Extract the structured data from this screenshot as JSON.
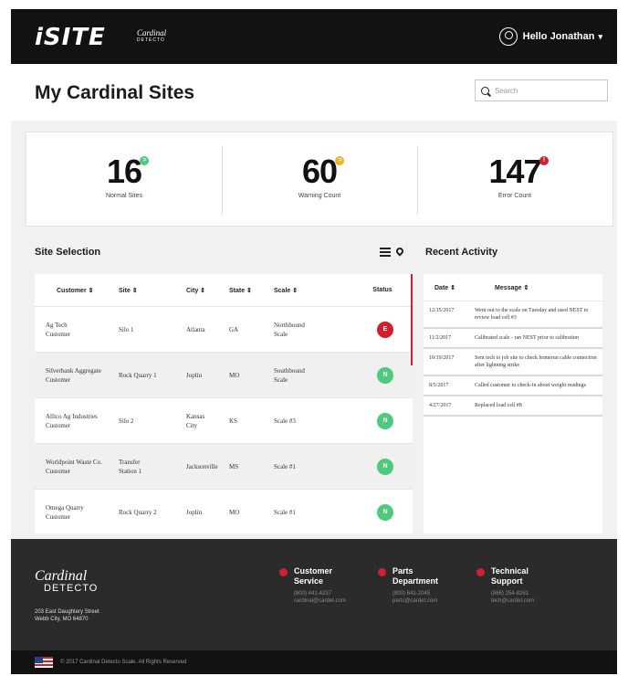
{
  "header": {
    "logo_text": "iSITE",
    "logo_sub": "Cardinal",
    "logo_sub2": "DETECTO",
    "greeting": "Hello Jonathan",
    "chevron": "chevron-down-icon"
  },
  "page": {
    "title": "My Cardinal Sites",
    "search_placeholder": "Search"
  },
  "stats": [
    {
      "value": "16",
      "label": "Normal Sites",
      "badge_color": "#4dca7c",
      "badge": ">"
    },
    {
      "value": "60",
      "label": "Warning Count",
      "badge_color": "#f0b429",
      "badge": ">"
    },
    {
      "value": "147",
      "label": "Error Count",
      "badge_color": "#d0202e",
      "badge": "!"
    }
  ],
  "site_selection": {
    "title": "Site Selection",
    "columns": [
      "Customer ⇕",
      "Site ⇕",
      "City ⇕",
      "State ⇕",
      "Scale ⇕",
      "Status"
    ],
    "rows": [
      {
        "customer": "Ag Tech\nCustomer",
        "site": "Silo 1",
        "city": "Atlanta",
        "state": "GA",
        "scale": "Northbound\nScale",
        "status": "E"
      },
      {
        "customer": "Silverbank Aggregate\nCustomer",
        "site": "Rock Quarry 1",
        "city": "Joplin",
        "state": "MO",
        "scale": "Southbound\nScale",
        "status": "N"
      },
      {
        "customer": "Allico Ag Industries\nCustomer",
        "site": "Silo 2",
        "city": "Kansas\nCity",
        "state": "KS",
        "scale": "Scale #3",
        "status": "N"
      },
      {
        "customer": "Worldpoint Waste Co.\nCustomer",
        "site": "Transfer\nStation 1",
        "city": "Jacksonville",
        "state": "MS",
        "scale": "Scale #1",
        "status": "N"
      },
      {
        "customer": "Omega Quarry\nCustomer",
        "site": "Rock Quarry 2",
        "city": "Joplin",
        "state": "MO",
        "scale": "Scale #1",
        "status": "N"
      }
    ]
  },
  "recent_activity": {
    "title": "Recent Activity",
    "columns": [
      "Date ⇕",
      "Message ⇕"
    ],
    "rows": [
      {
        "date": "12/15/2017",
        "message": "Went out to the scale on Tuesday and used NEST to review  load cell #3"
      },
      {
        "date": "11/2/2017",
        "message": "Calibrated scale - ran NEST prior to calibration"
      },
      {
        "date": "10/19/2017",
        "message": "Sent tech to job site to check homerun cable connection after lightning strike"
      },
      {
        "date": "8/5/2017",
        "message": "Called customer to check-in about weight readings"
      },
      {
        "date": "4/27/2017",
        "message": "Replaced load cell #8"
      }
    ]
  },
  "footer": {
    "logo": "Cardinal",
    "logo_sub": "DETECTO",
    "address": [
      "203 East Daughtery Street",
      "Webb City, MO 64870"
    ],
    "contacts": [
      {
        "title": [
          "Customer",
          "Service"
        ],
        "phone": "(800) 441-4237",
        "email": "cardinal@cardet.com"
      },
      {
        "title": [
          "Parts",
          "Department"
        ],
        "phone": "(800) 641-2045",
        "email": "parts@cardet.com"
      },
      {
        "title": [
          "Technical",
          "Support"
        ],
        "phone": "(866) 254-8261",
        "email": "tech@cardet.com"
      }
    ],
    "copyright": "© 2017 Cardinal Detecto Scale. All Rights Reserved"
  }
}
